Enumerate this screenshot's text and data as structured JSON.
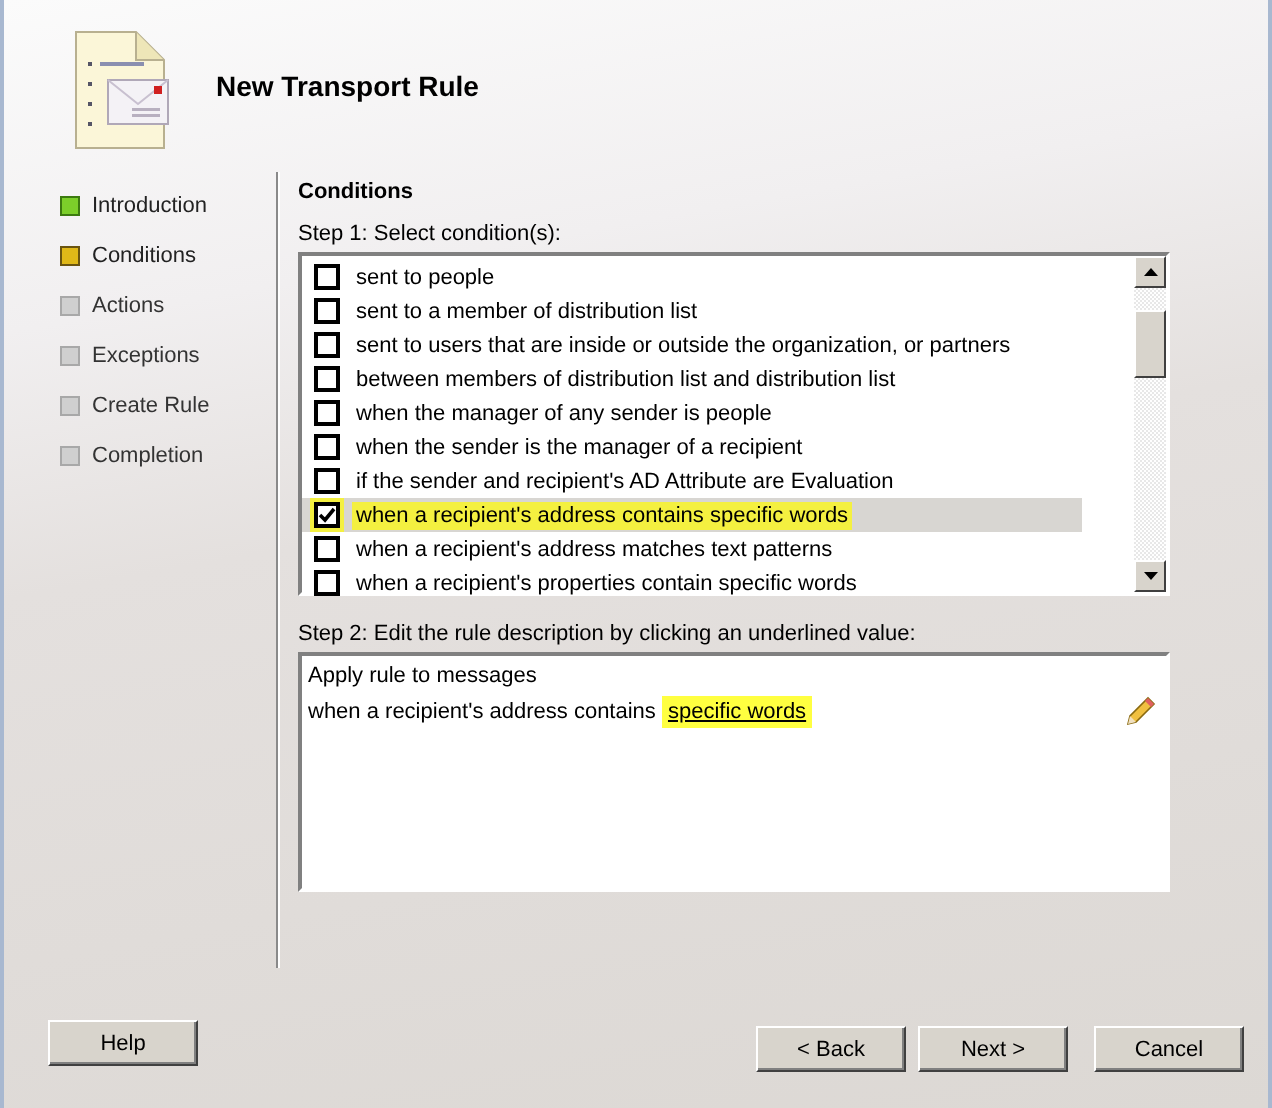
{
  "window": {
    "title": "New Transport Rule"
  },
  "steps": [
    {
      "label": "Introduction",
      "completed": true,
      "selected": false
    },
    {
      "label": "Conditions",
      "completed": false,
      "selected": true
    },
    {
      "label": "Actions",
      "completed": false,
      "selected": false
    },
    {
      "label": "Exceptions",
      "completed": false,
      "selected": false
    },
    {
      "label": "Create Rule",
      "completed": false,
      "selected": false
    },
    {
      "label": "Completion",
      "completed": false,
      "selected": false
    }
  ],
  "section_title": "Conditions",
  "step1": {
    "label": "Step 1: Select condition(s):",
    "conditions": [
      {
        "text": "sent to people",
        "checked": false,
        "selected": false,
        "highlighted": false
      },
      {
        "text": "sent to a member of distribution list",
        "checked": false,
        "selected": false,
        "highlighted": false
      },
      {
        "text": "sent to users that are inside or outside the organization, or partners",
        "checked": false,
        "selected": false,
        "highlighted": false
      },
      {
        "text": "between members of distribution list and distribution list",
        "checked": false,
        "selected": false,
        "highlighted": false
      },
      {
        "text": "when the manager of any sender is people",
        "checked": false,
        "selected": false,
        "highlighted": false
      },
      {
        "text": "when the sender is the manager of a recipient",
        "checked": false,
        "selected": false,
        "highlighted": false
      },
      {
        "text": "if the sender and recipient's AD Attribute are Evaluation",
        "checked": false,
        "selected": false,
        "highlighted": false
      },
      {
        "text": "when a recipient's address contains specific words",
        "checked": true,
        "selected": true,
        "highlighted": true
      },
      {
        "text": "when a recipient's address matches text patterns",
        "checked": false,
        "selected": false,
        "highlighted": false
      },
      {
        "text": "when a recipient's properties contain specific words",
        "checked": false,
        "selected": false,
        "highlighted": false
      }
    ]
  },
  "step2": {
    "label": "Step 2: Edit the rule description by clicking an underlined value:",
    "lines": [
      {
        "text": "Apply rule to messages"
      },
      {
        "text": "when a recipient's address contains",
        "link": "specific words",
        "highlighted": true
      }
    ]
  },
  "buttons": {
    "help": "Help",
    "back": "< Back",
    "next": "Next >",
    "cancel": "Cancel"
  }
}
